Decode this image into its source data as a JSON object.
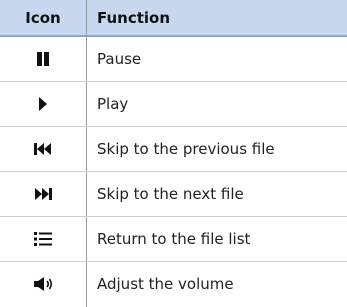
{
  "header": {
    "icon": "Icon",
    "function": "Function"
  },
  "rows": [
    {
      "icon": "pause-icon",
      "label": "Pause"
    },
    {
      "icon": "play-icon",
      "label": "Play"
    },
    {
      "icon": "skip-previous-icon",
      "label": "Skip to the previous file"
    },
    {
      "icon": "skip-next-icon",
      "label": "Skip to the next file"
    },
    {
      "icon": "list-icon",
      "label": "Return to the file list"
    },
    {
      "icon": "volume-icon",
      "label": "Adjust the volume"
    }
  ]
}
